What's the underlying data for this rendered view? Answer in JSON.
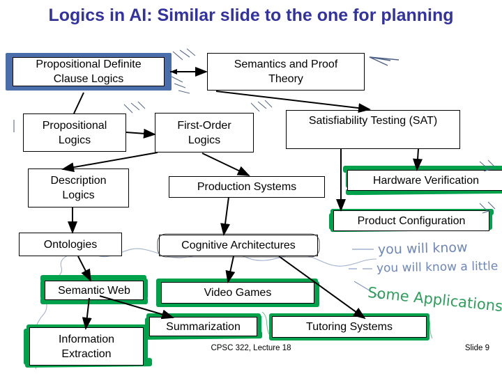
{
  "slide": {
    "title": "Logics in AI: Similar slide to the one for planning",
    "title_color": "#3333A0",
    "background": "#ffffff",
    "highlight_green": "#00A14B",
    "highlight_blue": "#4A6EA9",
    "ink_blue": "#6E86B8",
    "ink_green": "#2E9E5B"
  },
  "nodes": [
    {
      "id": "propositional-definite-clause-logics",
      "label": "Propositional Definite\nClause  Logics",
      "line1": "Propositional Definite",
      "line2": "Clause  Logics",
      "highlight": "blue"
    },
    {
      "id": "semantics-and-proof-theory",
      "label": "Semantics and Proof\nTheory",
      "line1": "Semantics and Proof",
      "line2": "Theory",
      "highlight": "none"
    },
    {
      "id": "propositional-logics",
      "label": "Propositional\nLogics",
      "line1": "Propositional",
      "line2": "Logics",
      "highlight": "none"
    },
    {
      "id": "first-order-logics",
      "label": "First-Order\nLogics",
      "line1": "First-Order",
      "line2": "Logics",
      "highlight": "none"
    },
    {
      "id": "satisfiability-testing-sat",
      "label": "Satisfiability Testing (SAT)",
      "highlight": "none"
    },
    {
      "id": "description-logics",
      "label": "Description\nLogics",
      "line1": "Description",
      "line2": "Logics",
      "highlight": "none"
    },
    {
      "id": "production-systems",
      "label": "Production Systems",
      "highlight": "none"
    },
    {
      "id": "hardware-verification",
      "label": "Hardware Verification",
      "highlight": "green"
    },
    {
      "id": "product-configuration",
      "label": "Product Configuration",
      "highlight": "green"
    },
    {
      "id": "ontologies",
      "label": "Ontologies",
      "highlight": "none"
    },
    {
      "id": "cognitive-architectures",
      "label": "Cognitive Architectures",
      "highlight": "pen-outline"
    },
    {
      "id": "semantic-web",
      "label": "Semantic Web",
      "highlight": "green"
    },
    {
      "id": "video-games",
      "label": "Video Games",
      "highlight": "green"
    },
    {
      "id": "summarization",
      "label": "Summarization",
      "highlight": "green"
    },
    {
      "id": "tutoring-systems",
      "label": "Tutoring Systems",
      "highlight": "green"
    },
    {
      "id": "information-extraction",
      "label": "Information\nExtraction",
      "line1": "Information",
      "line2": "Extraction",
      "highlight": "green"
    }
  ],
  "annotations": {
    "you_will_know": "you will know",
    "you_will_know_a_little": "you will know a little",
    "some_applications": "Some Applications"
  },
  "footer": {
    "course": "CPSC 322, Lecture 18",
    "slide_number": "Slide 9"
  }
}
